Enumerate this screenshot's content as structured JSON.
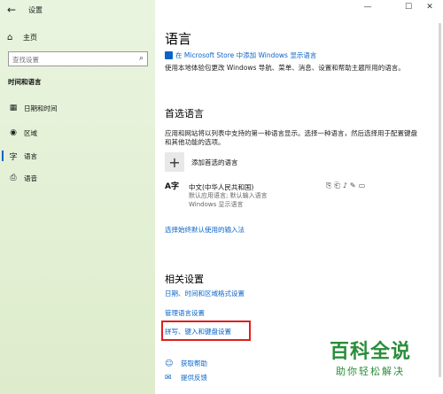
{
  "window": {
    "title": "设置",
    "back_icon": "←",
    "minimize": "—",
    "maximize": "☐",
    "close": "✕"
  },
  "sidebar": {
    "home": {
      "icon": "⌂",
      "label": "主页"
    },
    "search": {
      "placeholder": "查找设置",
      "icon": "⌕"
    },
    "section": "时间和语言",
    "items": [
      {
        "icon": "▦",
        "label": "日期和时间"
      },
      {
        "icon": "◉",
        "label": "区域"
      },
      {
        "icon": "字",
        "label": "语言"
      },
      {
        "icon": "⎙",
        "label": "语音"
      }
    ]
  },
  "main": {
    "title": "语言",
    "store_link": "在 Microsoft Store 中添加 Windows 显示语言",
    "description": "使用本地体验包更改 Windows 导航、菜单、消息、设置和帮助主题所用的语言。",
    "preferred": {
      "heading": "首选语言",
      "description": "应用和网站将以列表中支持的第一种语言显示。选择一种语言，然后选择用于配置键盘和其他功能的选项。",
      "add_label": "添加首选的语言",
      "language": {
        "glyph": "A字",
        "name": "中文(中华人民共和国)",
        "sub1": "默认应用语言; 默认输入语言",
        "sub2": "Windows 显示语言"
      },
      "cap_icons": [
        "⎘",
        "⎗",
        "♪",
        "✎",
        "▭"
      ],
      "input_method_link": "选择始终默认使用的输入法"
    },
    "related": {
      "heading": "相关设置",
      "links": [
        "日期、时间和区域格式设置",
        "管理语言设置",
        "拼写、键入和键盘设置"
      ]
    },
    "help": [
      {
        "icon": "☺",
        "label": "获取帮助"
      },
      {
        "icon": "✉",
        "label": "提供反馈"
      }
    ]
  },
  "watermark": {
    "big": "百科全说",
    "small": "助你轻松解决"
  },
  "colors": {
    "accent": "#0a64c8",
    "highlight": "#e21e1e",
    "sidebar": "#e3f0d4",
    "watermark": "#2a8d3a"
  }
}
